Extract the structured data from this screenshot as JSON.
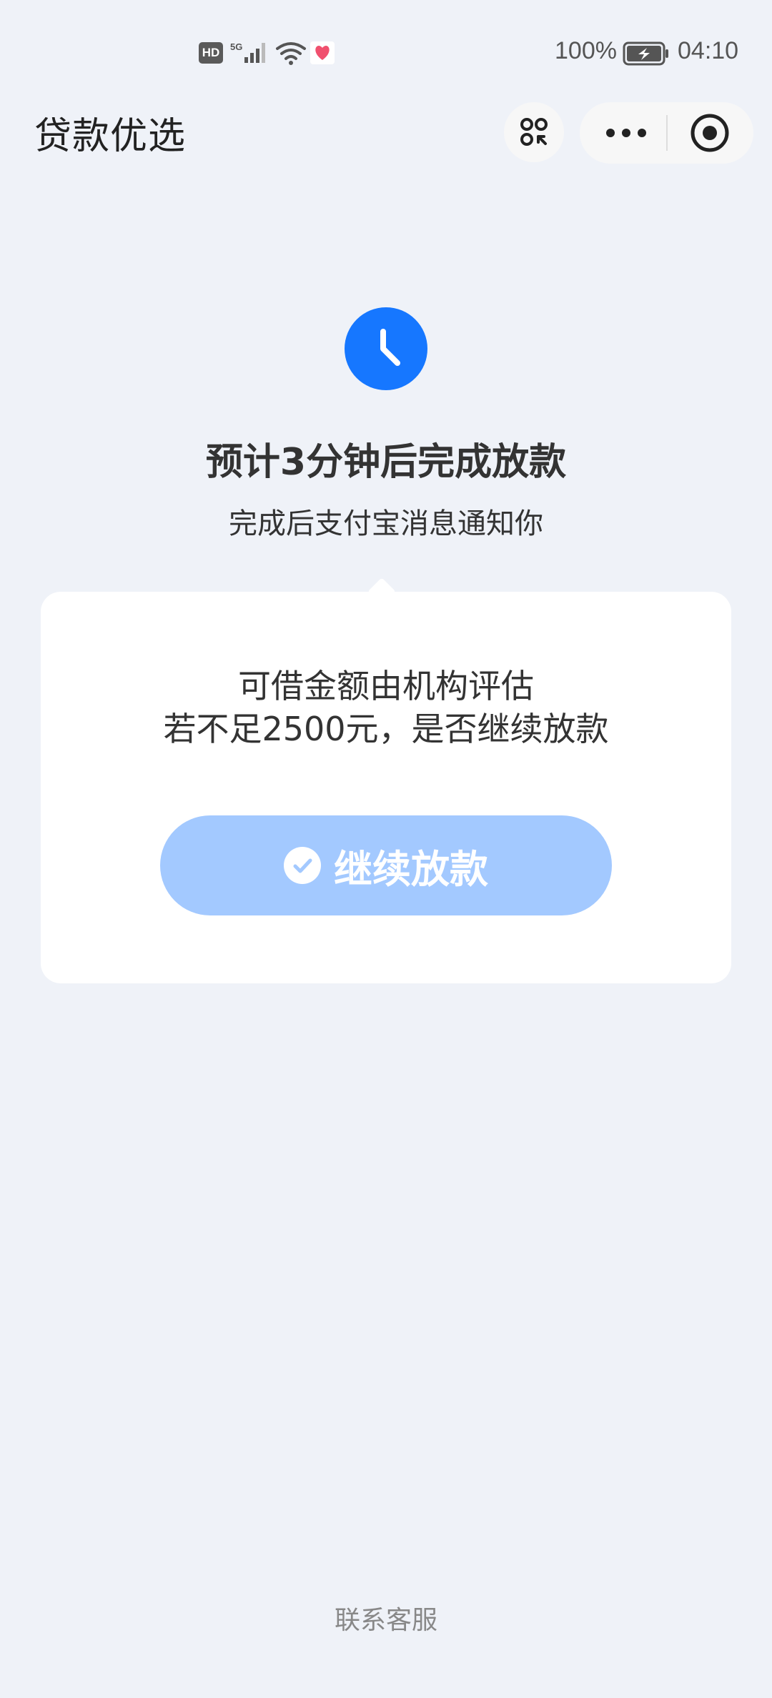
{
  "status_bar": {
    "hd_label": "HD",
    "network_label": "5G",
    "battery_percent": "100%",
    "time": "04:10"
  },
  "header": {
    "title": "贷款优选"
  },
  "main": {
    "headline": "预计3分钟后完成放款",
    "subline": "完成后支付宝消息通知你"
  },
  "card": {
    "line1": "可借金额由机构评估",
    "line2": "若不足2500元，是否继续放款",
    "button_label": "继续放款"
  },
  "footer": {
    "contact_label": "联系客服"
  },
  "colors": {
    "accent": "#1677ff",
    "button_bg": "#a3c9ff",
    "page_bg": "#eff2f8"
  },
  "icons": {
    "clock": "clock-icon",
    "check": "check-icon",
    "apps": "apps-icon",
    "more": "more-dots-icon",
    "close": "close-target-icon"
  }
}
